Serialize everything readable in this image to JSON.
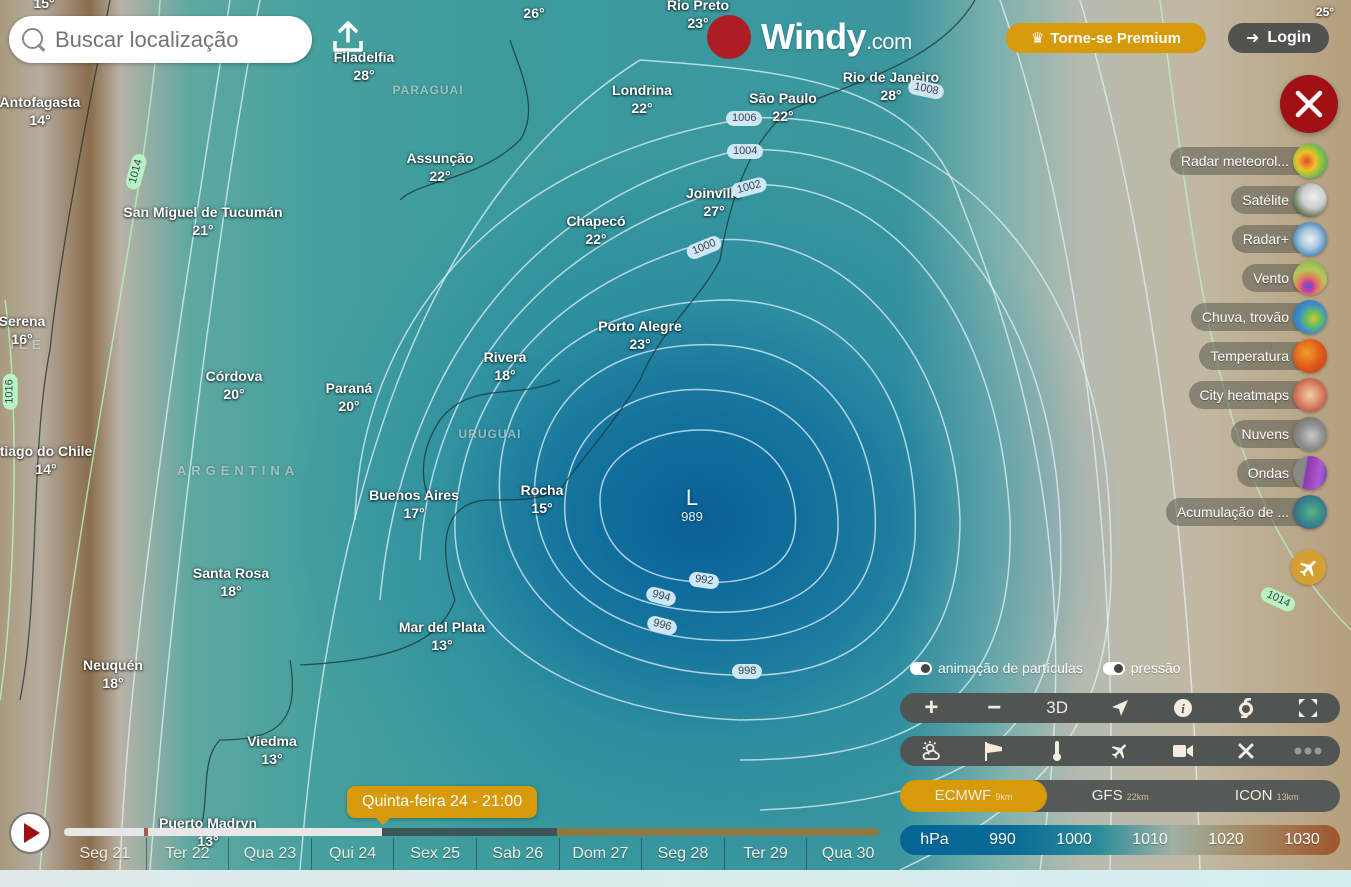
{
  "app": {
    "logo_main": "Windy",
    "logo_suffix": ".com",
    "premium_label": "Torne-se Premium",
    "login_label": "Login"
  },
  "search": {
    "placeholder": "Buscar localização",
    "value": ""
  },
  "map": {
    "cities": [
      {
        "name": "Filadelfia",
        "temp": "28°"
      },
      {
        "name": "Antofagasta",
        "temp": "14°"
      },
      {
        "name": "Rio Preto",
        "temp": "23°"
      },
      {
        "name": "Londrina",
        "temp": "22°"
      },
      {
        "name": "São Paulo",
        "temp": "22°"
      },
      {
        "name": "Rio de Janeiro",
        "temp": "28°"
      },
      {
        "name": "Assunção",
        "temp": "22°"
      },
      {
        "name": "Joinville",
        "temp": "27°"
      },
      {
        "name": "San Miguel de Tucumán",
        "temp": "21°"
      },
      {
        "name": "Chapecó",
        "temp": "22°"
      },
      {
        "name": "Serena",
        "temp": "16°"
      },
      {
        "name": "Porto Alegre",
        "temp": "23°"
      },
      {
        "name": "Rivera",
        "temp": "18°"
      },
      {
        "name": "Córdova",
        "temp": "20°"
      },
      {
        "name": "Paraná",
        "temp": "20°"
      },
      {
        "name": "tiago do Chile",
        "temp": "14°"
      },
      {
        "name": "Buenos Aires",
        "temp": "17°"
      },
      {
        "name": "Rocha",
        "temp": "15°"
      },
      {
        "name": "Santa Rosa",
        "temp": "18°"
      },
      {
        "name": "Mar del Plata",
        "temp": "13°"
      },
      {
        "name": "Neuquén",
        "temp": "18°"
      },
      {
        "name": "Viedma",
        "temp": "13°"
      },
      {
        "name": "Puerto Madryn",
        "temp": "13°"
      }
    ],
    "edge_temps": {
      "top_left": "15°",
      "top_mid": "26°",
      "top_right": "25°"
    },
    "countries": [
      "PARAGUAI",
      "URUGUAI",
      "ARGENTINA",
      "ILE"
    ],
    "isobars": [
      "1008",
      "1006",
      "1004",
      "1002",
      "1000",
      "992",
      "994",
      "996",
      "998",
      "1014",
      "1016",
      "1014"
    ],
    "low_pressure": {
      "symbol": "L",
      "value": "989"
    }
  },
  "layers": [
    {
      "label": "Radar meteorol...",
      "icon": "radar-icon"
    },
    {
      "label": "Satélite",
      "icon": "satellite-icon"
    },
    {
      "label": "Radar+",
      "icon": "radar-plus-icon"
    },
    {
      "label": "Vento",
      "icon": "wind-icon"
    },
    {
      "label": "Chuva, trovão",
      "icon": "rain-icon"
    },
    {
      "label": "Temperatura",
      "icon": "temperature-icon"
    },
    {
      "label": "City heatmaps",
      "icon": "heatmap-icon"
    },
    {
      "label": "Nuvens",
      "icon": "clouds-icon"
    },
    {
      "label": "Ondas",
      "icon": "waves-icon"
    },
    {
      "label": "Acumulação de ...",
      "icon": "accumulation-icon"
    }
  ],
  "toggles": {
    "particles": {
      "label": "animação de partículas",
      "on": true
    },
    "pressure": {
      "label": "pressão",
      "on": true
    }
  },
  "toolbar1": {
    "zoom_in": "+",
    "zoom_out": "−",
    "three_d": "3D"
  },
  "models": [
    {
      "name": "ECMWF",
      "res": "9km",
      "active": true
    },
    {
      "name": "GFS",
      "res": "22km",
      "active": false
    },
    {
      "name": "ICON",
      "res": "13km",
      "active": false
    }
  ],
  "legend": {
    "unit": "hPa",
    "values": [
      "990",
      "1000",
      "1010",
      "1020",
      "1030"
    ]
  },
  "timeline": {
    "current": "Quinta-feira 24 - 21:00",
    "days": [
      "Seg 21",
      "Ter 22",
      "Qua 23",
      "Qui 24",
      "Sex 25",
      "Sab 26",
      "Dom 27",
      "Seg 28",
      "Ter 29",
      "Qua 30"
    ],
    "progress_fraction": 0.39
  }
}
